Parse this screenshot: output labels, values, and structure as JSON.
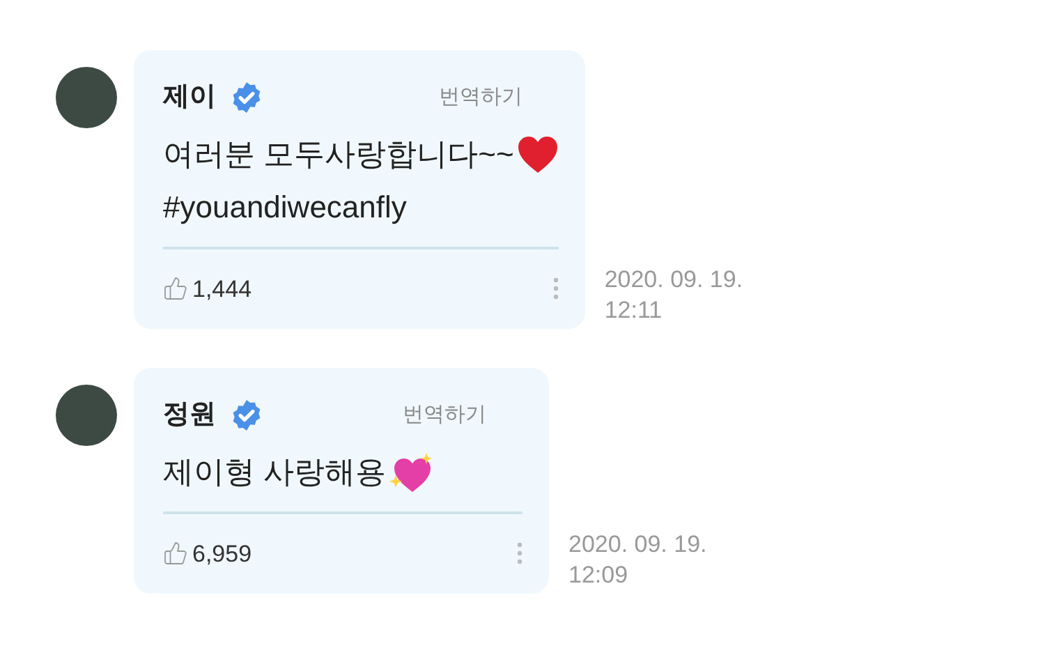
{
  "comments": [
    {
      "name": "제이",
      "verified": true,
      "translate": "번역하기",
      "lines": [
        {
          "text": "여러분 모두사랑합니다~~",
          "kind": "heart"
        },
        {
          "text": "#youandiwecanfly"
        }
      ],
      "likes": "1,444",
      "date": "2020. 09. 19.",
      "time": "12:11"
    },
    {
      "name": "정원",
      "verified": true,
      "translate": "번역하기",
      "lines": [
        {
          "text": "제이형 사랑해용",
          "kind": "sparkling-heart"
        }
      ],
      "likes": "6,959",
      "date": "2020. 09. 19.",
      "time": "12:09"
    }
  ]
}
